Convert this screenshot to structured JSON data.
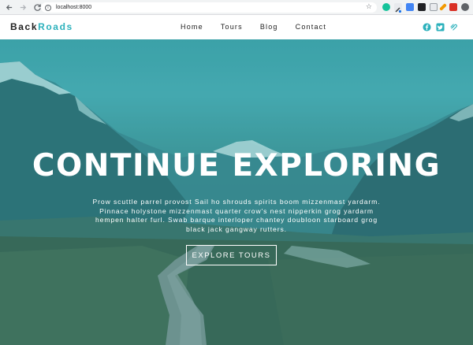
{
  "browser": {
    "url": "localhost:8000",
    "icons": [
      "back-icon",
      "forward-icon",
      "reload-icon",
      "home-icon",
      "info-icon",
      "bookmark-star-icon"
    ],
    "extensions": [
      "grammarly-extension-icon",
      "pen-extension-icon",
      "extension-icon",
      "layers-extension-icon",
      "calendar-extension-icon",
      "wrench-extension-icon",
      "puzzle-extension-icon",
      "account-extension-icon"
    ]
  },
  "header": {
    "logo_part1": "Back",
    "logo_part2": "Roads",
    "nav": [
      {
        "label": "Home"
      },
      {
        "label": "Tours"
      },
      {
        "label": "Blog"
      },
      {
        "label": "Contact"
      }
    ],
    "social": [
      "facebook-icon",
      "twitter-icon",
      "squarespace-icon"
    ]
  },
  "hero": {
    "title": "CONTINUE EXPLORING",
    "text_lines": [
      "Prow scuttle parrel provost Sail ho shrouds spirits boom mizzenmast yardarm.",
      "Pinnace holystone mizzenmast quarter crow's nest nipperkin grog yardarm",
      "hempen halter furl. Swab barque interloper chantey doubloon starboard grog",
      "black jack gangway rutters."
    ],
    "button_label": "EXPLORE TOURS"
  },
  "colors": {
    "brand": "#2cb1bc",
    "text_dark": "#222222",
    "hero_text": "#ffffff"
  }
}
